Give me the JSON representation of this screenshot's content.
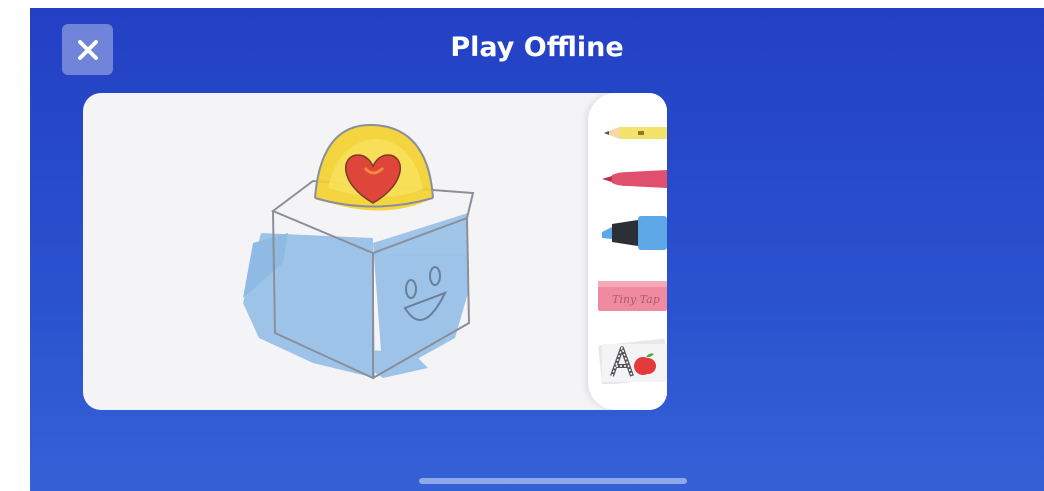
{
  "header": {
    "title": "Play Offline",
    "close_icon": "close-icon"
  },
  "drawing": {
    "subject": "cube-with-heart-dome-doodle"
  },
  "tools": [
    {
      "name": "pencil-tool",
      "icon": "pencil-icon",
      "color": "#f3e36a"
    },
    {
      "name": "marker-tool",
      "icon": "marker-icon",
      "color": "#e0506e"
    },
    {
      "name": "highlighter-tool",
      "icon": "highlighter-icon",
      "color": "#5fa8e8"
    },
    {
      "name": "eraser-tool",
      "icon": "eraser-icon",
      "color": "#f08aa0",
      "label": "Tiny Tap"
    },
    {
      "name": "letters-tool",
      "icon": "letter-a-apple-icon",
      "color": "#e33b3b"
    }
  ],
  "colors": {
    "background_top": "#2340c4",
    "background_bottom": "#3561d6",
    "card": "#f4f4f6"
  }
}
